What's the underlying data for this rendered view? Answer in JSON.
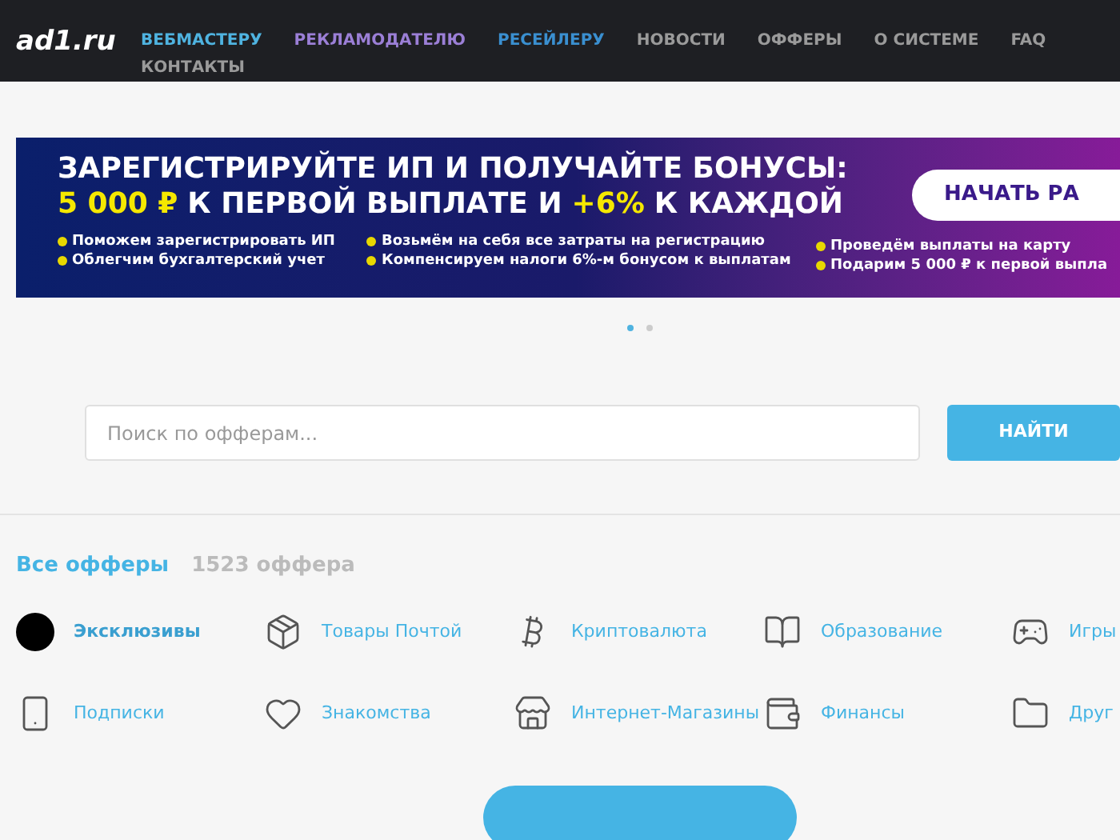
{
  "header": {
    "logo": "ad1.ru",
    "nav": [
      {
        "label": "ВЕБМАСТЕРУ",
        "color": "#4fb3e0"
      },
      {
        "label": "РЕКЛАМОДАТЕЛЮ",
        "color": "#9b7fd6"
      },
      {
        "label": "РЕСЕЙЛЕРУ",
        "color": "#3a8fd0"
      },
      {
        "label": "НОВОСТИ",
        "color": "#9a9a9a"
      },
      {
        "label": "ОФФЕРЫ",
        "color": "#9a9a9a"
      },
      {
        "label": "О СИСТЕМЕ",
        "color": "#9a9a9a"
      },
      {
        "label": "FAQ",
        "color": "#9a9a9a"
      },
      {
        "label": "КОНТАКТЫ",
        "color": "#9a9a9a"
      }
    ]
  },
  "banner": {
    "headline_1": "ЗАРЕГИСТРИРУЙТЕ ИП И ПОЛУЧАЙТЕ БОНУСЫ:",
    "headline_2": [
      {
        "text": "5 000 ₽",
        "highlight": true
      },
      {
        "text": "К ПЕРВОЙ ВЫПЛАТЕ И",
        "highlight": false
      },
      {
        "text": "+6%",
        "highlight": true
      },
      {
        "text": "К КАЖДОЙ",
        "highlight": false
      }
    ],
    "bullet_columns": [
      [
        "Поможем зарегистрировать ИП",
        "Облегчим бухгалтерский учет"
      ],
      [
        "Возьмём на себя все затраты на регистрацию",
        "Компенсируем налоги 6%-м бонусом к выплатам"
      ],
      [
        "Проведём выплаты на карту",
        "Подарим 5 000 ₽ к первой выпла"
      ]
    ],
    "cta": "НАЧАТЬ РА"
  },
  "carousel_dots": [
    {
      "selected": true
    },
    {
      "selected": false
    }
  ],
  "search": {
    "placeholder": "Поиск по офферам...",
    "button": "НАЙТИ"
  },
  "offers": {
    "title": "Все офферы",
    "count": "1523 оффера",
    "categories": [
      {
        "label": "Эксклюзивы",
        "kind": "logo",
        "selected": true
      },
      {
        "label": "Товары Почтой",
        "kind": "box",
        "selected": false
      },
      {
        "label": "Криптовалюта",
        "kind": "bitcoin",
        "selected": false
      },
      {
        "label": "Образование",
        "kind": "book",
        "selected": false
      },
      {
        "label": "Игры",
        "kind": "gamepad",
        "selected": false
      },
      {
        "label": "Подписки",
        "kind": "phone",
        "selected": false
      },
      {
        "label": "Знакомства",
        "kind": "heart",
        "selected": false
      },
      {
        "label": "Интернет-Магазины",
        "kind": "store",
        "selected": false
      },
      {
        "label": "Финансы",
        "kind": "wallet",
        "selected": false
      },
      {
        "label": "Друг",
        "kind": "folder",
        "selected": false
      }
    ]
  }
}
